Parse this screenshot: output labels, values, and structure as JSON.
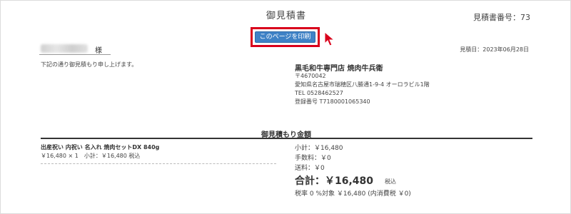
{
  "header": {
    "title": "御見積書",
    "quote_number_label": "見積書番号：73"
  },
  "print_button": {
    "label": "このページを印刷"
  },
  "customer": {
    "honorific": "様",
    "intro": "下記の通り御見積もり申し上げます。"
  },
  "quote_date": "見積日：2023年06月28日",
  "shop": {
    "name": "黒毛和牛専門店 焼肉牛兵衛",
    "postal": "〒4670042",
    "address": "愛知県名古屋市瑞穂区八勝通1-9-4 オーロラビル1階",
    "tel": "TEL 0528462527",
    "registration": "登録番号 T7180001065340"
  },
  "section_title": "御見積もり金額",
  "item": {
    "name": "出産祝い 内祝い 名入れ 焼肉セットDX 840g",
    "detail": "￥16,480 × 1　小計：￥16,480 税込"
  },
  "summary": {
    "subtotal": "小計：￥16,480",
    "fee": "手数料：￥0",
    "shipping": "送料：￥0",
    "total": "合計：￥16,480",
    "total_tax_note": "税込",
    "tax_line": "税率 0 %対象 ￥16,480 (内消費税 ￥0)"
  },
  "colors": {
    "highlight": "#d9001b",
    "button": "#3f82c6"
  }
}
